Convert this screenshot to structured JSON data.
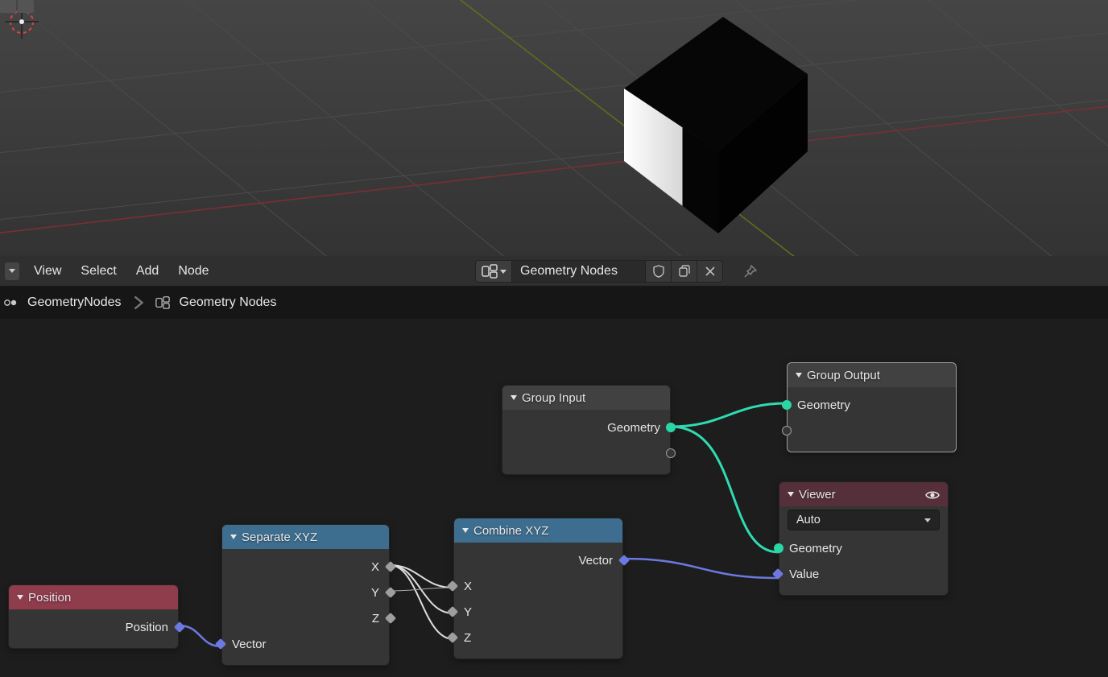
{
  "header": {
    "menu": {
      "view": "View",
      "select": "Select",
      "add": "Add",
      "node": "Node"
    },
    "nodetree_name": "Geometry Nodes"
  },
  "breadcrumb": {
    "modifier": "GeometryNodes",
    "nodetree": "Geometry Nodes"
  },
  "nodes": {
    "position": {
      "title": "Position",
      "outputs": {
        "position": "Position"
      }
    },
    "separate": {
      "title": "Separate XYZ",
      "outputs": {
        "x": "X",
        "y": "Y",
        "z": "Z"
      },
      "inputs": {
        "vector": "Vector"
      }
    },
    "combine": {
      "title": "Combine XYZ",
      "outputs": {
        "vector": "Vector"
      },
      "inputs": {
        "x": "X",
        "y": "Y",
        "z": "Z"
      }
    },
    "group_input": {
      "title": "Group Input",
      "outputs": {
        "geometry": "Geometry"
      }
    },
    "group_output": {
      "title": "Group Output",
      "inputs": {
        "geometry": "Geometry"
      }
    },
    "viewer": {
      "title": "Viewer",
      "domain_mode": "Auto",
      "inputs": {
        "geometry": "Geometry",
        "value": "Value"
      }
    }
  }
}
